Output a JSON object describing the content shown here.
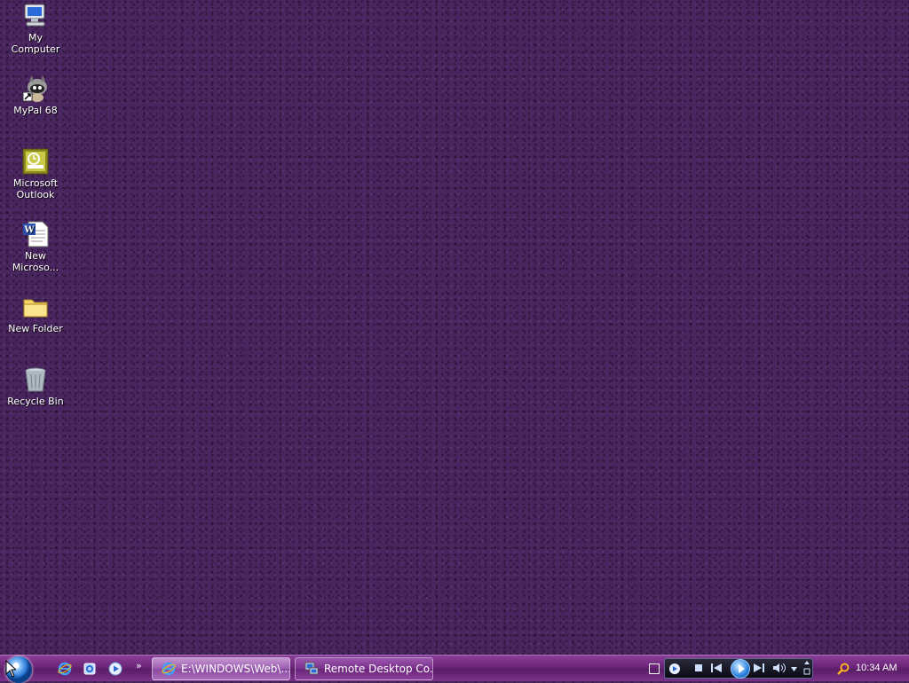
{
  "desktop": {
    "icons": [
      {
        "label": "My Computer",
        "icon": "my-computer-icon"
      },
      {
        "label": "MyPal 68",
        "icon": "mypal-raccoon-icon"
      },
      {
        "label": "Microsoft Outlook",
        "icon": "outlook-icon"
      },
      {
        "label": "New Microso...",
        "icon": "word-document-icon"
      },
      {
        "label": "New Folder",
        "icon": "folder-icon"
      },
      {
        "label": "Recycle Bin",
        "icon": "recycle-bin-icon"
      }
    ]
  },
  "taskbar": {
    "quick_launch_overflow": "»",
    "tasks": [
      {
        "label": "E:\\WINDOWS\\Web\\...",
        "icon": "internet-explorer-icon",
        "active": true
      },
      {
        "label": "Remote Desktop Co...",
        "icon": "remote-desktop-icon",
        "active": false
      }
    ],
    "clock": "10:34 AM"
  },
  "colors": {
    "wallpaper": "#4a2660",
    "taskbar": "#6b2478"
  }
}
